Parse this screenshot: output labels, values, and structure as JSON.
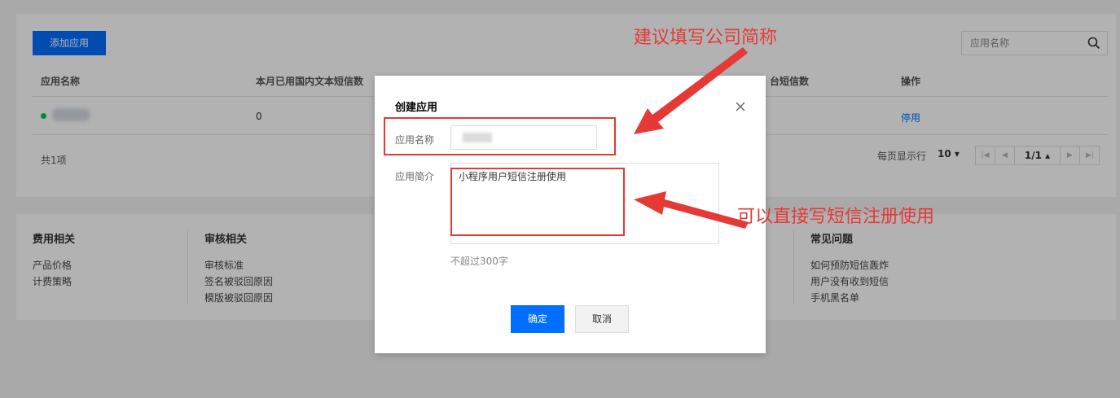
{
  "toolbar": {
    "add_app_label": "添加应用"
  },
  "search": {
    "placeholder": "应用名称",
    "icon": "search-icon"
  },
  "table": {
    "columns": [
      "应用名称",
      "本月已用国内文本短信数",
      "操作"
    ],
    "columns_partial": [
      "台短信数"
    ],
    "rows": [
      {
        "status": "active",
        "status_color": "#0abf5b",
        "used_count": "0",
        "action": "停用"
      }
    ]
  },
  "pagination": {
    "total": "共1项",
    "page_size_label": "每页显示行",
    "page_size": "10 ▾",
    "current": "1/1 ▴"
  },
  "footer": {
    "sections": [
      {
        "title": "费用相关",
        "links": [
          "产品价格",
          "计费策略"
        ]
      },
      {
        "title": "审核相关",
        "links": [
          "审核标准",
          "签名被驳回原因",
          "模版被驳回原因"
        ]
      },
      {
        "title": "常见问题",
        "links": [
          "如何预防短信轰炸",
          "用户没有收到短信",
          "手机黑名单"
        ]
      }
    ]
  },
  "modal": {
    "title": "创建应用",
    "name_label": "应用名称",
    "desc_label": "应用简介",
    "desc_value": "小程序用户短信注册使用",
    "hint": "不超过300字",
    "ok_label": "确定",
    "cancel_label": "取消"
  },
  "annotations": {
    "top_note": "建议填写公司简称",
    "bottom_note": "可以直接写短信注册使用",
    "color": "#e53935"
  },
  "colors": {
    "primary": "#006eff",
    "accent_red": "#e53935",
    "success": "#0abf5b"
  }
}
